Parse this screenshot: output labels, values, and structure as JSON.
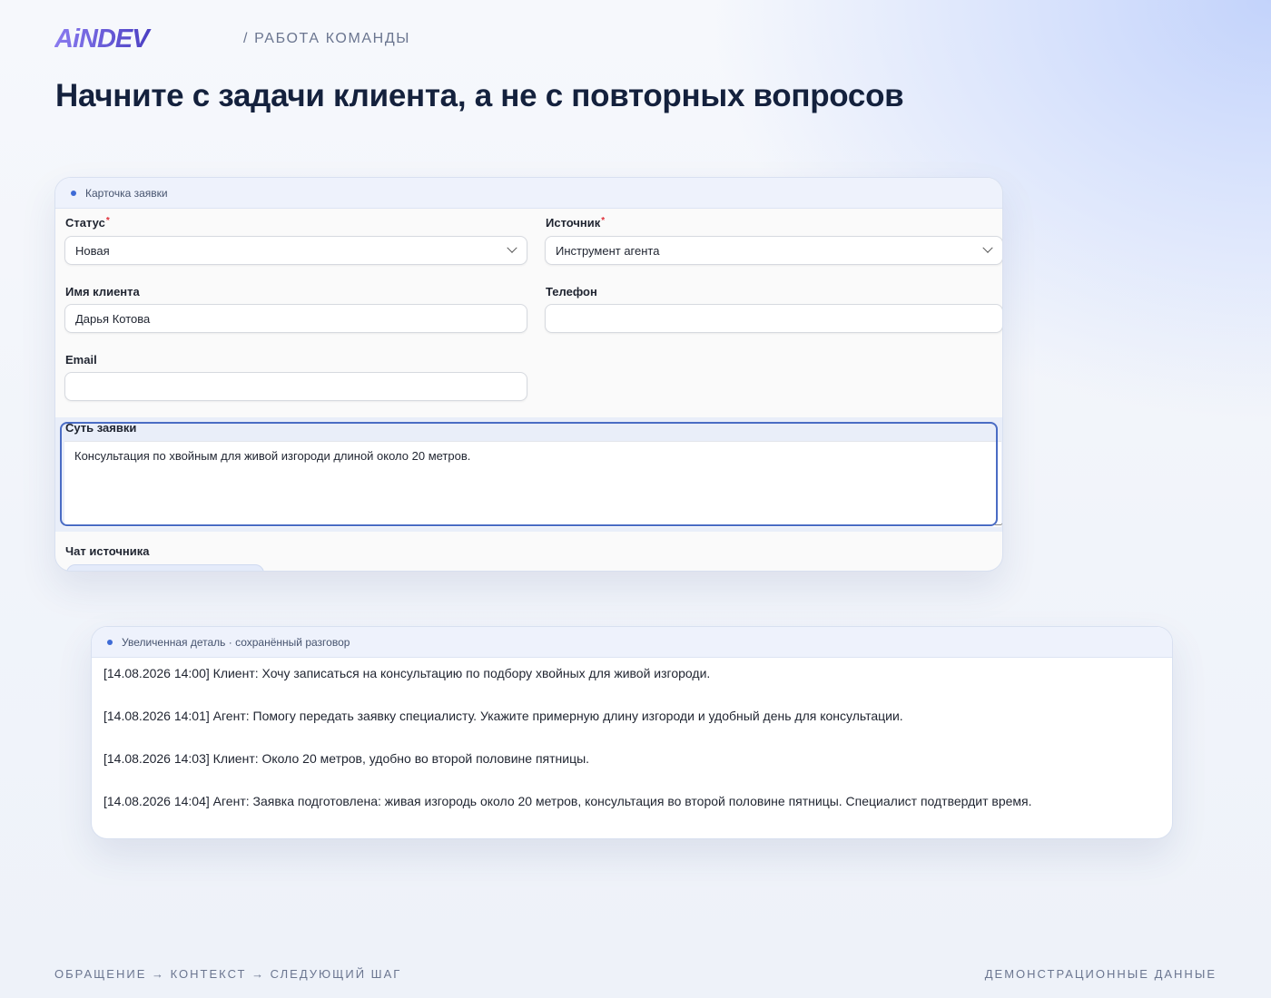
{
  "brand": {
    "logo_text": "AiNDEV"
  },
  "header": {
    "section": "/ РАБОТА КОМАНДЫ",
    "headline": "Начните с задачи клиента, а не с повторных вопросов"
  },
  "ticket_card": {
    "title": "Карточка заявки",
    "fields": {
      "status": {
        "label": "Статус",
        "required": "*",
        "value": "Новая"
      },
      "source": {
        "label": "Источник",
        "required": "*",
        "value": "Инструмент агента"
      },
      "client_name": {
        "label": "Имя клиента",
        "value": "Дарья Котова"
      },
      "phone": {
        "label": "Телефон",
        "value": ""
      },
      "email": {
        "label": "Email",
        "value": ""
      },
      "request": {
        "label": "Суть заявки",
        "value": "Консультация по хвойным для живой изгороди длиной около 20 метров."
      },
      "source_chat": {
        "label": "Чат источника"
      }
    }
  },
  "chat_card": {
    "title": "Увеличенная деталь · сохранённый разговор",
    "messages": [
      "[14.08.2026 14:00] Клиент: Хочу записаться на консультацию по подбору хвойных для живой изгороди.",
      "[14.08.2026 14:01] Агент: Помогу передать заявку специалисту. Укажите примерную длину изгороди и удобный день для консультации.",
      "[14.08.2026 14:03] Клиент: Около 20 метров, удобно во второй половине пятницы.",
      "[14.08.2026 14:04] Агент: Заявка подготовлена: живая изгородь около 20 метров, консультация во второй половине пятницы. Специалист подтвердит время."
    ]
  },
  "footer": {
    "flow": "ОБРАЩЕНИЕ → КОНТЕКСТ → СЛЕДУЮЩИЙ ШАГ",
    "note": "ДЕМОНСТРАЦИОННЫЕ ДАННЫЕ"
  },
  "colors": {
    "accent": "#3e6bd6",
    "focus_ring": "#4a6cc4",
    "headline": "#14213d",
    "brand_gradient_start": "#6d5be0",
    "brand_dark": "#1a1f3a"
  }
}
